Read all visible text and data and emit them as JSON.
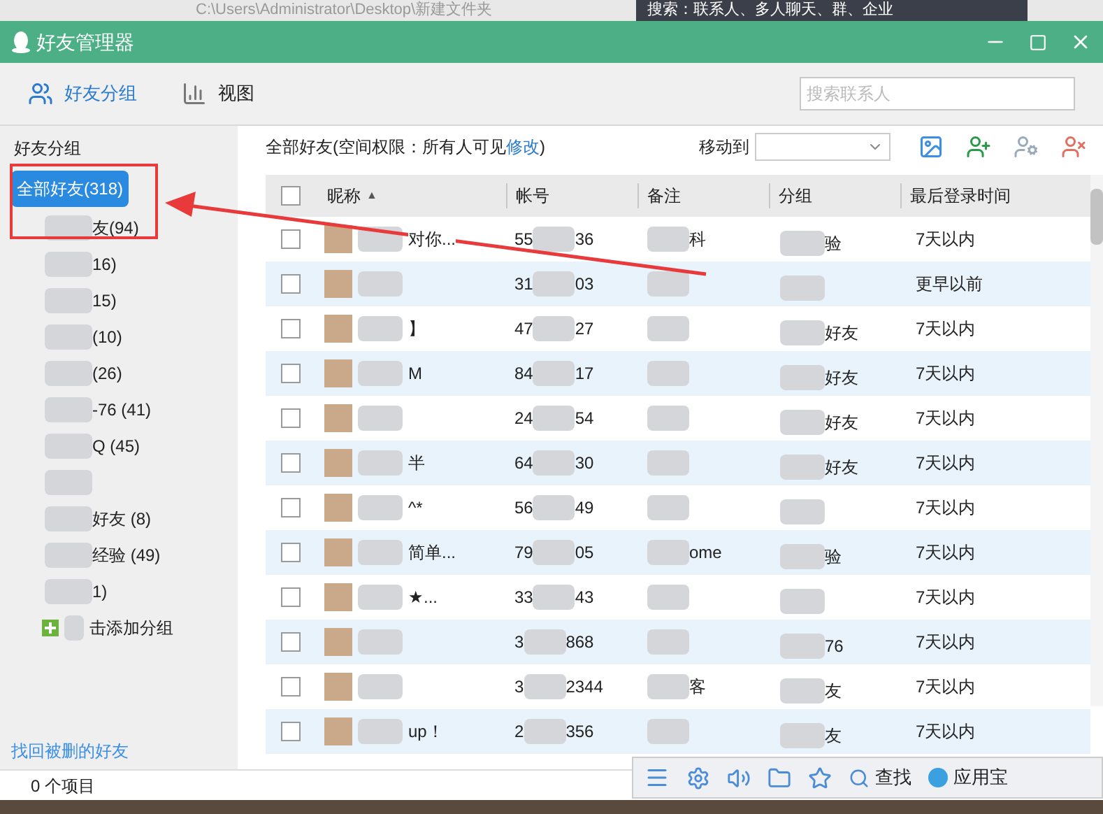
{
  "desktop": {
    "path": "C:\\Users\\Administrator\\Desktop\\新建文件夹",
    "search_hint": "搜索：联系人、多人聊天、群、企业"
  },
  "window": {
    "title": "好友管理器"
  },
  "tabs": [
    {
      "label": "好友分组",
      "selected": true
    },
    {
      "label": "视图",
      "selected": false
    }
  ],
  "search": {
    "placeholder": "搜索联系人"
  },
  "sidebar": {
    "heading": "好友分组",
    "groups": [
      {
        "label": "全部好友(318)",
        "selected": true
      },
      {
        "label": "友(94)",
        "selected": false
      },
      {
        "label": "16)",
        "selected": false
      },
      {
        "label": "15)",
        "selected": false
      },
      {
        "label": "(10)",
        "selected": false
      },
      {
        "label": "(26)",
        "selected": false
      },
      {
        "label": "-76 (41)",
        "selected": false
      },
      {
        "label": "Q (45)",
        "selected": false
      },
      {
        "selected": false
      },
      {
        "label": "好友 (8)",
        "selected": false
      },
      {
        "label": "经验 (49)",
        "selected": false
      },
      {
        "label": "1)",
        "selected": false
      }
    ],
    "add_group": "击添加分组",
    "recover_link": "找回被删的好友"
  },
  "header": {
    "scope": "全部好友(空间权限：所有人可见",
    "edit_link": "修改",
    "scope_end": ")",
    "move_to": "移动到"
  },
  "table": {
    "select_all": {
      "checked": false
    },
    "sort_mark": "▲",
    "columns": [
      "昵称",
      "帐号",
      "备注",
      "分组",
      "最后登录时间"
    ],
    "rows": [
      {
        "checked": false,
        "name": "对你...",
        "account_start": "55",
        "account_end": "36",
        "note": "科",
        "group": "验",
        "last_login": "7天以内"
      },
      {
        "checked": false,
        "account_start": "31",
        "account_end": "03",
        "last_login": "更早以前"
      },
      {
        "checked": false,
        "name": "】",
        "account_start": "47",
        "account_end": "27",
        "group": "好友",
        "last_login": "7天以内"
      },
      {
        "checked": false,
        "name": "M",
        "account_start": "84",
        "account_end": "17",
        "group": "好友",
        "last_login": "7天以内"
      },
      {
        "checked": false,
        "account_start": "24",
        "account_end": "54",
        "group": "好友",
        "last_login": "7天以内"
      },
      {
        "checked": false,
        "name": "半",
        "account_start": "64",
        "account_end": "30",
        "group": "好友",
        "last_login": "7天以内"
      },
      {
        "checked": false,
        "name": "^*",
        "account_start": "56",
        "account_end": "49",
        "last_login": "7天以内"
      },
      {
        "checked": false,
        "name": "简单...",
        "account_start": "79",
        "account_end": "05",
        "note": "ome",
        "group": "验",
        "last_login": "7天以内"
      },
      {
        "checked": false,
        "name": "★...",
        "account_start": "33",
        "account_end": "43",
        "last_login": "7天以内"
      },
      {
        "checked": false,
        "account_start": "3",
        "account_end": "868",
        "group": "76",
        "last_login": "7天以内"
      },
      {
        "checked": false,
        "account_start": "3",
        "account_end": "2344",
        "note": "客",
        "group": "友",
        "last_login": "7天以内"
      },
      {
        "checked": false,
        "name": "up！",
        "account_start": "2",
        "account_end": "356",
        "group": "友",
        "last_login": "7天以内"
      }
    ]
  },
  "status_bar": {
    "count": "0 个项目"
  },
  "qq_panel": {
    "find": "查找",
    "app_store": "应用宝"
  }
}
